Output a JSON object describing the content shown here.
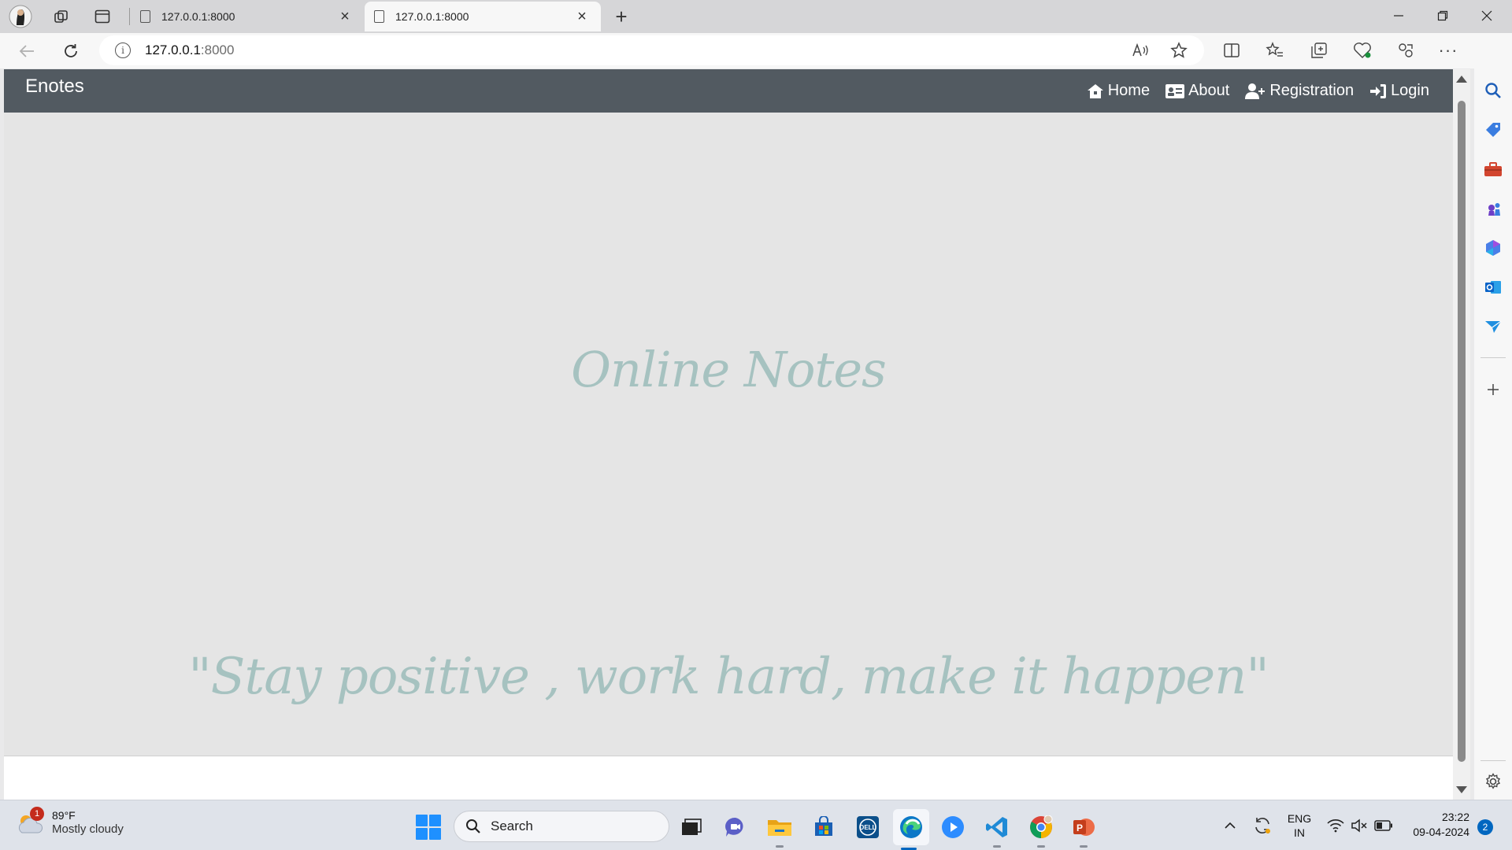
{
  "browser": {
    "tabs": [
      {
        "title": "127.0.0.1:8000",
        "active": false
      },
      {
        "title": "127.0.0.1:8000",
        "active": true
      }
    ],
    "url": {
      "host": "127.0.0.1",
      "port": ":8000"
    }
  },
  "page": {
    "brand": "Enotes",
    "nav": [
      {
        "label": "Home",
        "icon": "home-icon"
      },
      {
        "label": "About",
        "icon": "id-card-icon"
      },
      {
        "label": "Registration",
        "icon": "user-plus-icon"
      },
      {
        "label": "Login",
        "icon": "sign-in-icon"
      }
    ],
    "hero_title": "Online Notes",
    "hero_quote": "\"Stay positive , work hard, make it happen\"",
    "colors": {
      "navbar": "#525a61",
      "hero_bg": "#e5e5e5",
      "hero_text": "#a6c2c0"
    }
  },
  "taskbar": {
    "weather": {
      "badge": "1",
      "temp": "89°F",
      "condition": "Mostly cloudy"
    },
    "search_placeholder": "Search",
    "lang": {
      "line1": "ENG",
      "line2": "IN"
    },
    "clock": {
      "time": "23:22",
      "date": "09-04-2024"
    },
    "notifications": "2"
  }
}
